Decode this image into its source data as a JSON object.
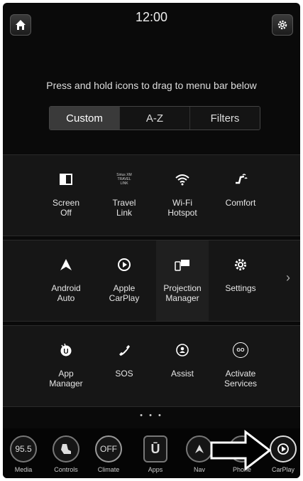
{
  "header": {
    "time": "12:00",
    "home_icon": "home-icon",
    "settings_icon": "gear-icon"
  },
  "instruction": "Press and hold icons to drag to menu bar below",
  "tabs": [
    {
      "label": "Custom",
      "active": true
    },
    {
      "label": "A-Z",
      "active": false
    },
    {
      "label": "Filters",
      "active": false
    }
  ],
  "rows": [
    [
      {
        "icon": "screen-off-icon",
        "label": "Screen\nOff"
      },
      {
        "icon": "travel-link-icon",
        "label": "Travel\nLink",
        "logo_text": "Sirius XM\nTRAVEL\nLINK"
      },
      {
        "icon": "wifi-icon",
        "label": "Wi-Fi\nHotspot"
      },
      {
        "icon": "comfort-icon",
        "label": "Comfort"
      }
    ],
    [
      {
        "icon": "android-auto-icon",
        "label": "Android\nAuto"
      },
      {
        "icon": "carplay-icon",
        "label": "Apple\nCarPlay"
      },
      {
        "icon": "projection-icon",
        "label": "Projection\nManager"
      },
      {
        "icon": "gear-icon",
        "label": "Settings"
      }
    ],
    [
      {
        "icon": "app-manager-icon",
        "label": "App\nManager"
      },
      {
        "icon": "sos-phone-icon",
        "label": "SOS"
      },
      {
        "icon": "assist-icon",
        "label": "Assist"
      },
      {
        "icon": "go-icon",
        "label": "Activate\nServices",
        "icon_text": "GO"
      }
    ]
  ],
  "page_indicator": "• • •",
  "dock": [
    {
      "icon_text": "95.5",
      "label": "Media"
    },
    {
      "icon": "controls-icon",
      "label": "Controls"
    },
    {
      "icon_text": "OFF",
      "label": "Climate"
    },
    {
      "icon": "apps-icon",
      "label": "Apps",
      "icon_text": "Ū"
    },
    {
      "icon": "nav-icon",
      "label": "Nav"
    },
    {
      "icon": "phone-icon",
      "label": "Phone"
    },
    {
      "icon": "carplay-icon",
      "label": "CarPlay"
    }
  ],
  "colors": {
    "background": "#0a0a0a",
    "tile": "#161616"
  }
}
